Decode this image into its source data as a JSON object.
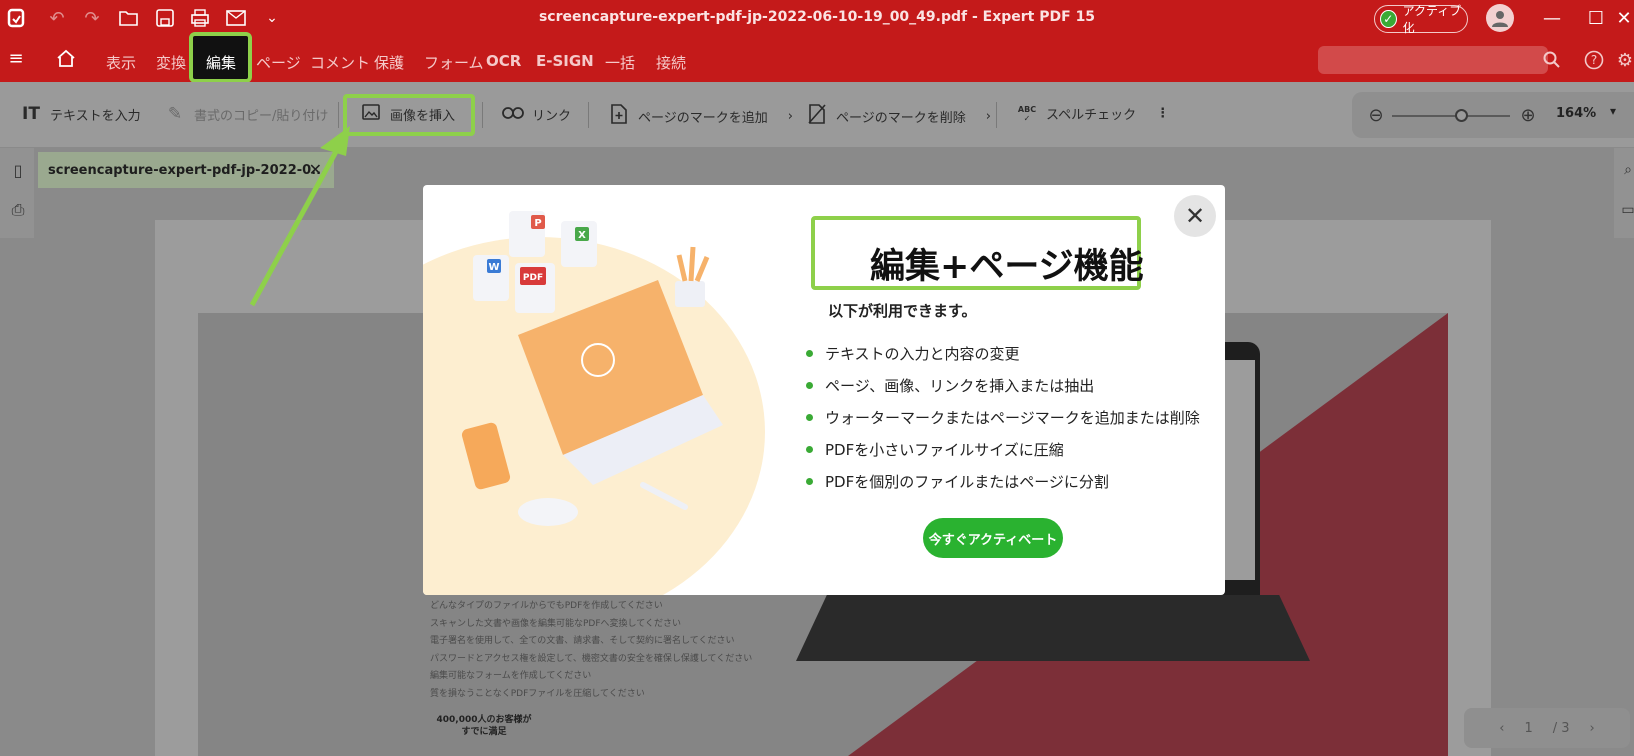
{
  "titlebar": {
    "title": "screencapture-expert-pdf-jp-2022-06-10-19_00_49.pdf   -   Expert PDF 15",
    "activate_label": "アクティブ化"
  },
  "menu": {
    "items": [
      "表示",
      "変換",
      "編集",
      "ページ",
      "コメント",
      "保護",
      "フォーム",
      "OCR",
      "E-SIGN",
      "一括",
      "接続"
    ],
    "active": "編集"
  },
  "toolbar": {
    "text_input": "テキストを入力",
    "copy_format": "書式のコピー/貼り付け",
    "insert_image": "画像を挿入",
    "link": "リンク",
    "add_page_mark": "ページのマークを追加",
    "remove_page_mark": "ページのマークを削除",
    "spellcheck": "スペルチェック",
    "zoom": "164%"
  },
  "tab": {
    "label": "screencapture-expert-pdf-jp-2022-0..."
  },
  "document": {
    "bullets": [
      "どんなタイプのファイルからでもPDFを作成してください",
      "スキャンした文書や画像を編集可能なPDFへ変換してください",
      "電子署名を使用して、全ての文書、請求書、そして契約に署名してください",
      "パスワードとアクセス権を設定して、機密文書の安全を確保し保護してください",
      "編集可能なフォームを作成してください",
      "質を損なうことなくPDFファイルを圧縮してください"
    ],
    "badge_line1": "400,000人のお客様が",
    "badge_line2": "すでに満足",
    "page_current": "1",
    "page_total": "/ 3"
  },
  "modal": {
    "title": "編集+ページ機能",
    "subtitle": "以下が利用できます。",
    "features": [
      "テキストの入力と内容の変更",
      "ページ、画像、リンクを挿入または抽出",
      "ウォーターマークまたはページマークを追加または削除",
      "PDFを小さいファイルサイズに圧縮",
      "PDFを個別のファイルまたはページに分割"
    ],
    "cta": "今すぐアクティベート",
    "illustration_labels": [
      "P",
      "X",
      "W",
      "PDF"
    ]
  },
  "colors": {
    "brand_red": "#c41a1a",
    "highlight_green": "#8ed04a",
    "cta_green": "#2ab230"
  }
}
